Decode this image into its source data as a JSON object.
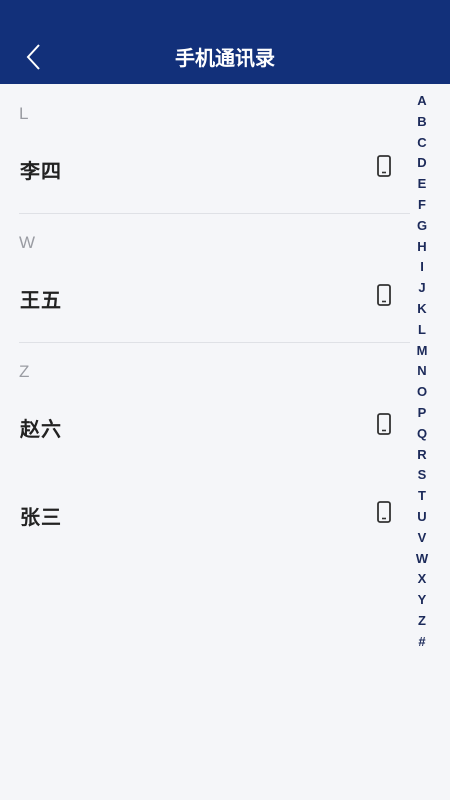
{
  "header": {
    "title": "手机通讯录"
  },
  "sections": [
    {
      "letter": "L",
      "contacts": [
        {
          "name": "李四"
        }
      ]
    },
    {
      "letter": "W",
      "contacts": [
        {
          "name": "王五"
        }
      ]
    },
    {
      "letter": "Z",
      "contacts": [
        {
          "name": "赵六"
        },
        {
          "name": "张三"
        }
      ]
    }
  ],
  "index": [
    "A",
    "B",
    "C",
    "D",
    "E",
    "F",
    "G",
    "H",
    "I",
    "J",
    "K",
    "L",
    "M",
    "N",
    "O",
    "P",
    "Q",
    "R",
    "S",
    "T",
    "U",
    "V",
    "W",
    "X",
    "Y",
    "Z",
    "#"
  ],
  "colors": {
    "header_bg": "#12307a",
    "index_text": "#1c2a5a"
  }
}
